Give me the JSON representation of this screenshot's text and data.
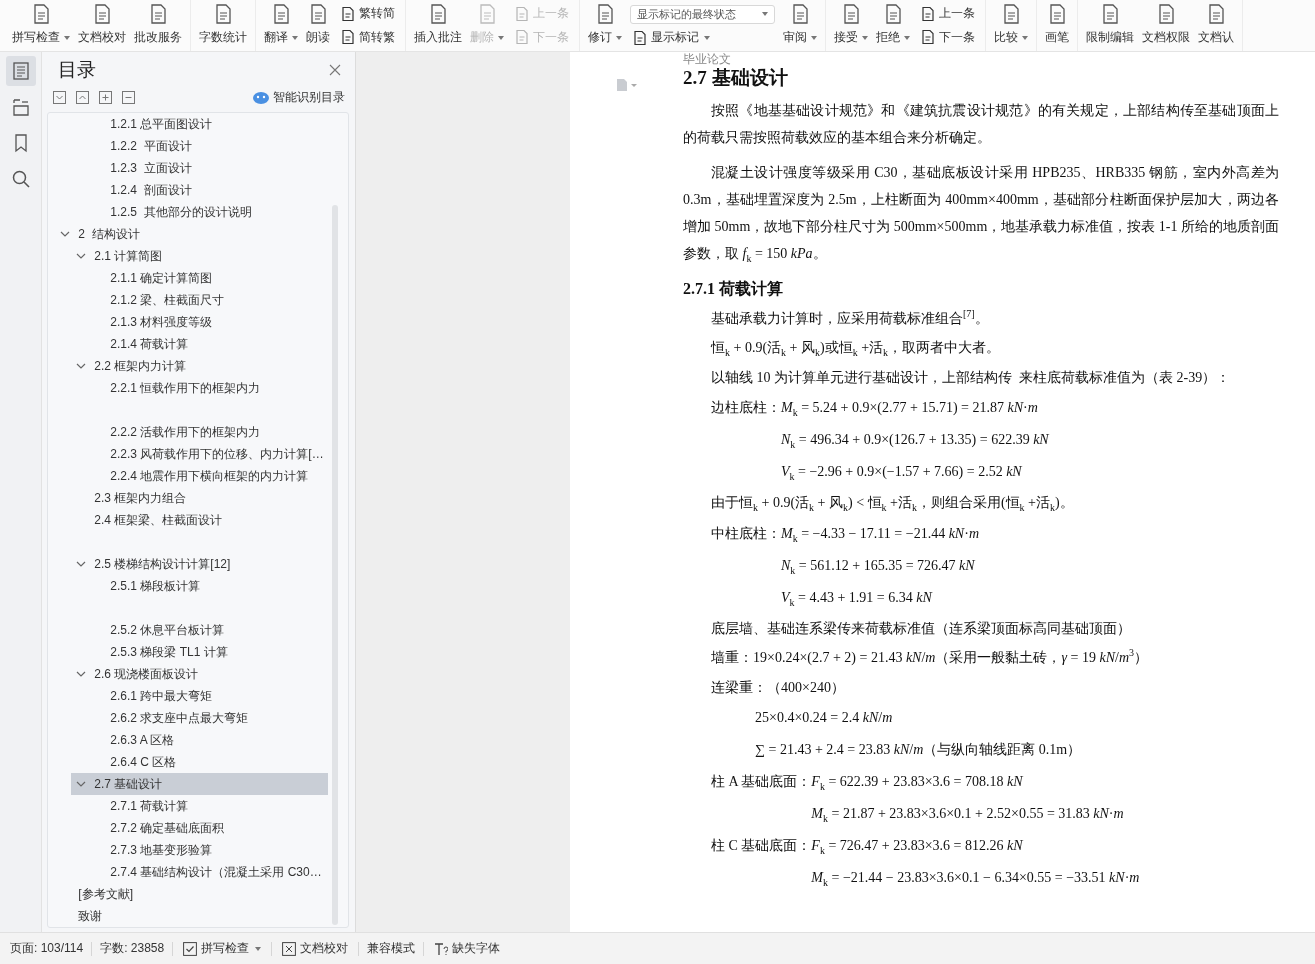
{
  "toolbar": {
    "groups": [
      {
        "items": [
          {
            "kind": "big",
            "label": "拼写检查",
            "dropdown": true,
            "disabled": false
          },
          {
            "kind": "big",
            "label": "文档校对",
            "dropdown": false,
            "disabled": false
          },
          {
            "kind": "big",
            "label": "批改服务",
            "dropdown": false,
            "disabled": false
          }
        ]
      },
      {
        "items": [
          {
            "kind": "big",
            "label": "字数统计",
            "dropdown": false,
            "disabled": false
          }
        ]
      },
      {
        "items": [
          {
            "kind": "big",
            "label": "翻译",
            "dropdown": true,
            "disabled": false
          },
          {
            "kind": "big",
            "label": "朗读",
            "dropdown": false,
            "disabled": false
          },
          {
            "kind": "stack",
            "items": [
              {
                "kind": "small",
                "label": "繁转简",
                "dropdown": false,
                "disabled": false
              },
              {
                "kind": "small",
                "label": "简转繁",
                "dropdown": false,
                "disabled": false
              }
            ]
          }
        ]
      },
      {
        "items": [
          {
            "kind": "big",
            "label": "插入批注",
            "dropdown": false,
            "disabled": false
          },
          {
            "kind": "big",
            "label": "删除",
            "dropdown": true,
            "disabled": true
          },
          {
            "kind": "stack",
            "items": [
              {
                "kind": "small",
                "label": "上一条",
                "dropdown": false,
                "disabled": true
              },
              {
                "kind": "small",
                "label": "下一条",
                "dropdown": false,
                "disabled": true
              }
            ]
          }
        ]
      },
      {
        "items": [
          {
            "kind": "big",
            "label": "修订",
            "dropdown": true,
            "disabled": false
          },
          {
            "kind": "stack",
            "items": [
              {
                "kind": "select",
                "value": "显示标记的最终状态"
              },
              {
                "kind": "small",
                "label": "显示标记",
                "dropdown": true,
                "disabled": false
              }
            ]
          },
          {
            "kind": "big",
            "label": "审阅",
            "dropdown": true,
            "disabled": false
          }
        ]
      },
      {
        "items": [
          {
            "kind": "big",
            "label": "接受",
            "dropdown": true,
            "disabled": false
          },
          {
            "kind": "big",
            "label": "拒绝",
            "dropdown": true,
            "disabled": false
          },
          {
            "kind": "stack",
            "items": [
              {
                "kind": "small",
                "label": "上一条",
                "dropdown": false,
                "disabled": false
              },
              {
                "kind": "small",
                "label": "下一条",
                "dropdown": false,
                "disabled": false
              }
            ]
          }
        ]
      },
      {
        "items": [
          {
            "kind": "big",
            "label": "比较",
            "dropdown": true,
            "disabled": false
          }
        ]
      },
      {
        "items": [
          {
            "kind": "big",
            "label": "画笔",
            "dropdown": false,
            "disabled": false
          }
        ]
      },
      {
        "items": [
          {
            "kind": "big",
            "label": "限制编辑",
            "dropdown": false,
            "disabled": false
          },
          {
            "kind": "big",
            "label": "文档权限",
            "dropdown": false,
            "disabled": false
          },
          {
            "kind": "big",
            "label": "文档认",
            "dropdown": false,
            "disabled": false
          }
        ]
      }
    ]
  },
  "rail": [
    {
      "selected": true
    },
    {
      "selected": false
    },
    {
      "selected": false
    },
    {
      "selected": false
    }
  ],
  "toc": {
    "title": "目录",
    "smart_link": "智能识别目录",
    "tree": [
      {
        "children": [
          {
            "children": [
              {
                "label": "1.2.1 总平面图设计",
                "selected": false
              },
              {
                "label": "1.2.2  平面设计",
                "selected": false
              },
              {
                "label": "1.2.3  立面设计",
                "selected": false
              },
              {
                "label": "1.2.4  剖面设计",
                "selected": false
              },
              {
                "label": "1.2.5  其他部分的设计说明",
                "selected": false
              }
            ]
          }
        ]
      },
      {
        "label": "2  结构设计",
        "selected": false,
        "expanded": true,
        "children": [
          {
            "label": "2.1 计算简图",
            "selected": false,
            "expanded": true,
            "children": [
              {
                "label": "2.1.1 确定计算简图",
                "selected": false
              },
              {
                "label": "2.1.2 梁、柱截面尺寸",
                "selected": false
              },
              {
                "label": "2.1.3 材料强度等级",
                "selected": false
              },
              {
                "label": "2.1.4 荷载计算",
                "selected": false
              }
            ]
          },
          {
            "label": "2.2 框架内力计算",
            "selected": false,
            "expanded": true,
            "children": [
              {
                "label": "2.2.1 恒载作用下的框架内力",
                "selected": false,
                "spacer_after": true
              },
              {
                "label": "2.2.2 活载作用下的框架内力",
                "selected": false
              },
              {
                "label": "2.2.3 风荷载作用下的位移、内力计算[…",
                "selected": false
              },
              {
                "label": "2.2.4 地震作用下横向框架的内力计算",
                "selected": false
              }
            ]
          },
          {
            "label": "2.3 框架内力组合",
            "selected": false
          },
          {
            "label": "2.4 框架梁、柱截面设计",
            "selected": false,
            "spacer_after": true
          },
          {
            "label": "2.5 楼梯结构设计计算[12]",
            "selected": false,
            "expanded": true,
            "children": [
              {
                "label": "2.5.1 梯段板计算",
                "selected": false,
                "spacer_after": true
              },
              {
                "label": "2.5.2 休息平台板计算",
                "selected": false
              },
              {
                "label": "2.5.3 梯段梁 TL1 计算",
                "selected": false
              }
            ]
          },
          {
            "label": "2.6 现浇楼面板设计",
            "selected": false,
            "expanded": true,
            "children": [
              {
                "label": "2.6.1 跨中最大弯矩",
                "selected": false
              },
              {
                "label": "2.6.2 求支座中点最大弯矩",
                "selected": false
              },
              {
                "label": "2.6.3 A 区格",
                "selected": false
              },
              {
                "label": "2.6.4 C 区格",
                "selected": false
              }
            ]
          },
          {
            "label": "2.7 基础设计",
            "selected": true,
            "expanded": true,
            "children": [
              {
                "label": "2.7.1 荷载计算",
                "selected": false
              },
              {
                "label": "2.7.2 确定基础底面积",
                "selected": false
              },
              {
                "label": "2.7.3 地基变形验算",
                "selected": false
              },
              {
                "label": "2.7.4 基础结构设计（混凝土采用 C30…",
                "selected": false
              }
            ]
          }
        ]
      },
      {
        "label": "[参考文献]",
        "selected": false
      },
      {
        "label": "致谢",
        "selected": false
      }
    ]
  },
  "document": {
    "blocks": [
      {
        "kind": "header",
        "text": "毕业论文"
      },
      {
        "kind": "h2",
        "text": "2.7 基础设计"
      },
      {
        "kind": "para",
        "text": "按照《地基基础设计规范》和《建筑抗震设计规范》的有关规定，上部结构传至基础顶面上的荷载只需按照荷载效应的基本组合来分析确定。"
      },
      {
        "kind": "para",
        "text": "混凝土设计强度等级采用 C30，基础底板设计采用 HPB235、HRB335 钢筋，室内外高差为 0.3m，基础埋置深度为 2.5m，上柱断面为 400mm×400mm，基础部分柱断面保护层加大，两边各增加 50mm，故地下部分柱尺寸为 500mm×500mm，地基承载力标准值，按表 1-1 所给的地质剖面参数，取 *f*$_{k}$ = 150 *kPa*。"
      },
      {
        "kind": "h3",
        "text": "2.7.1 荷载计算"
      },
      {
        "kind": "line",
        "text": "基础承载力计算时，应采用荷载标准组合$^{[7]}$。"
      },
      {
        "kind": "line",
        "text": "恒$_{k}$ + 0.9(活$_{k}$ + 风$_{k}$)或恒$_{k}$ +活$_{k}$，取两者中大者。"
      },
      {
        "kind": "line",
        "text": "以轴线 10 为计算单元进行基础设计，上部结构传  来柱底荷载标准值为（表 2-39）："
      },
      {
        "kind": "eqgroup",
        "label": "边柱底柱：",
        "rows": [
          "*M*$_{k}$ = 5.24 + 0.9×(2.77 + 15.71) = 21.87 *kN*·*m*",
          "*N*$_{k}$ = 496.34 + 0.9×(126.7 + 13.35) = 622.39 *kN*",
          "*V*$_{k}$ = −2.96 + 0.9×(−1.57 + 7.66) = 2.52 *kN*"
        ]
      },
      {
        "kind": "line",
        "text": "由于恒$_{k}$ + 0.9(活$_{k}$ + 风$_{k}$) < 恒$_{k}$ +活$_{k}$，则组合采用(恒$_{k}$ +活$_{k}$)。"
      },
      {
        "kind": "eqgroup",
        "label": "中柱底柱：",
        "rows": [
          "*M*$_{k}$ = −4.33 − 17.11 = −21.44 *kN*·*m*",
          "*N*$_{k}$ = 561.12 + 165.35 = 726.47 *kN*",
          "*V*$_{k}$ = 4.43 + 1.91 = 6.34 *kN*"
        ]
      },
      {
        "kind": "line",
        "text": "底层墙、基础连系梁传来荷载标准值（连系梁顶面标高同基础顶面）"
      },
      {
        "kind": "line",
        "text": "墙重：19×0.24×(2.7 + 2) = 21.43 *kN*/*m*（采用一般黏土砖，*γ* = 19 *kN*/*m*$^{3}$）"
      },
      {
        "kind": "line",
        "text": "连梁重：（400×240）"
      },
      {
        "kind": "eqgroup",
        "rows": [
          "25×0.4×0.24 = 2.4 *kN*/*m*",
          "∑ = 21.43 + 2.4 = 23.83 *kN*/*m*（与纵向轴线距离 0.1m）"
        ]
      },
      {
        "kind": "eqgroup",
        "label": "柱 A 基础底面：",
        "rows": [
          "*F*$_{k}$ = 622.39 + 23.83×3.6 = 708.18 *kN*",
          "*M*$_{k}$ = 21.87 + 23.83×3.6×0.1 + 2.52×0.55 = 31.83 *kN*·*m*"
        ]
      },
      {
        "kind": "eqgroup",
        "label": "柱 C 基础底面：",
        "rows": [
          "*F*$_{k}$ = 726.47 + 23.83×3.6 = 812.26 *kN*",
          "*M*$_{k}$ = −21.44 − 23.83×3.6×0.1 − 6.34×0.55 = −33.51 *kN*·*m*"
        ]
      }
    ]
  },
  "status_bar": [
    {
      "kind": "info",
      "label": "页面: 103/114"
    },
    {
      "kind": "info",
      "label": "字数: 23858"
    },
    {
      "kind": "spell",
      "label": "拼写检查"
    },
    {
      "kind": "proof",
      "label": "文档校对"
    },
    {
      "kind": "info",
      "label": "兼容模式"
    },
    {
      "kind": "font",
      "label": "缺失字体"
    }
  ]
}
